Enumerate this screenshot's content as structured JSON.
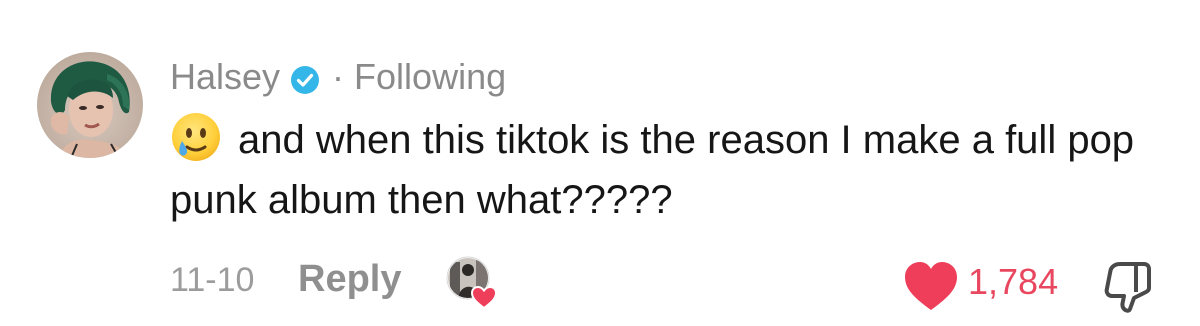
{
  "comment": {
    "username": "Halsey",
    "separator": "·",
    "relationship": "Following",
    "emoji_icon": "crying-smile-emoji-icon",
    "text": "and when this tiktok is the reason I make a full pop punk album then what?????",
    "date": "11-10",
    "reply_label": "Reply",
    "like_count": "1,784",
    "liked": true
  },
  "colors": {
    "verified_badge": "#35b6e9",
    "like_heart": "#ef3e5a",
    "like_count": "#e8475f",
    "meta_text": "#8a8a8a",
    "body_text": "#161616"
  },
  "icons": {
    "verified": "verified-badge-icon",
    "creator_liked": "creator-liked-heart-icon",
    "like": "heart-icon",
    "dislike": "thumbs-down-icon"
  }
}
